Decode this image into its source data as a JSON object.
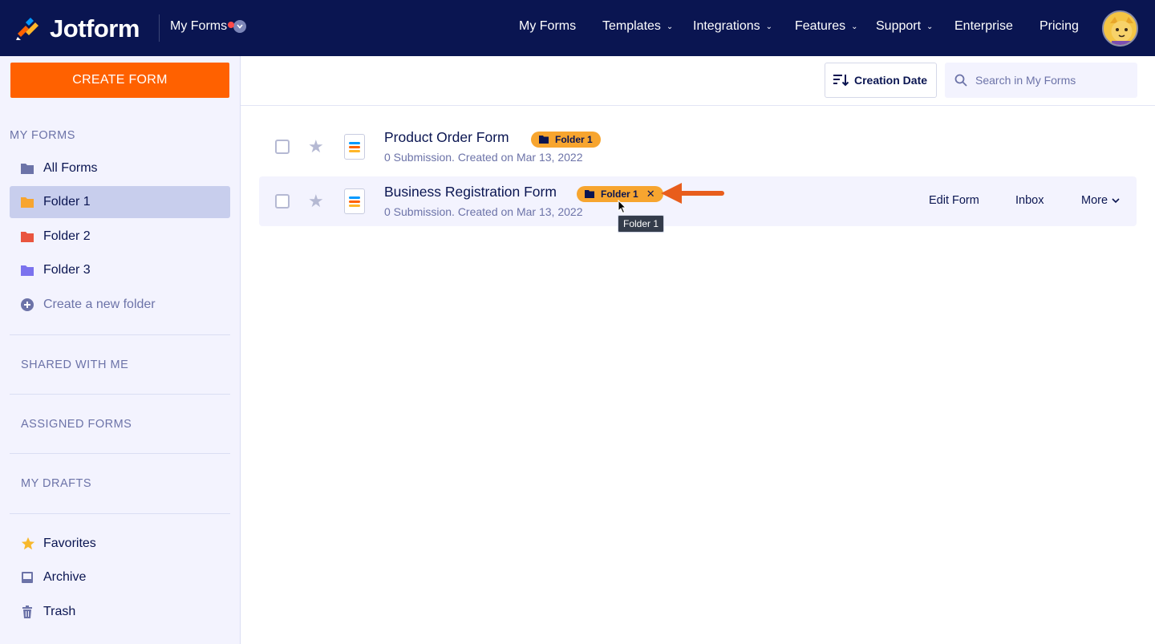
{
  "app": {
    "brand": "Jotform",
    "switcher_label": "My Forms"
  },
  "nav": {
    "items": [
      {
        "label": "My Forms",
        "has_caret": false
      },
      {
        "label": "Templates",
        "has_caret": true
      },
      {
        "label": "Integrations",
        "has_caret": true
      },
      {
        "label": "Features",
        "has_caret": true
      },
      {
        "label": "Support",
        "has_caret": true
      },
      {
        "label": "Enterprise",
        "has_caret": false
      },
      {
        "label": "Pricing",
        "has_caret": false
      }
    ]
  },
  "sidebar": {
    "create_label": "CREATE FORM",
    "my_forms_heading": "MY FORMS",
    "items": [
      {
        "label": "All Forms",
        "color": "#6c73a8"
      },
      {
        "label": "Folder 1",
        "color": "#f7a52f"
      },
      {
        "label": "Folder 2",
        "color": "#e9553f"
      },
      {
        "label": "Folder 3",
        "color": "#7b72ee"
      }
    ],
    "new_folder_label": "Create a new folder",
    "shared_heading": "SHARED WITH ME",
    "assigned_heading": "ASSIGNED FORMS",
    "drafts_heading": "MY DRAFTS",
    "bottom_items": [
      {
        "label": "Favorites",
        "icon": "star-icon"
      },
      {
        "label": "Archive",
        "icon": "archive-icon"
      },
      {
        "label": "Trash",
        "icon": "trash-icon"
      }
    ]
  },
  "toolbar": {
    "sort_label": "Creation Date",
    "search_placeholder": "Search in My Forms"
  },
  "forms": [
    {
      "title": "Product Order Form",
      "meta": "0 Submission. Created on Mar 13, 2022",
      "tag": "Folder 1"
    },
    {
      "title": "Business Registration Form",
      "meta": "0 Submission. Created on Mar 13, 2022",
      "tag": "Folder 1",
      "actions": {
        "edit": "Edit Form",
        "inbox": "Inbox",
        "more": "More"
      }
    }
  ],
  "tooltip": "Folder 1",
  "colors": {
    "navy": "#0a1551",
    "orange": "#ff6100",
    "tag": "#f7a52f",
    "sidebar_bg": "#f3f3fe"
  }
}
